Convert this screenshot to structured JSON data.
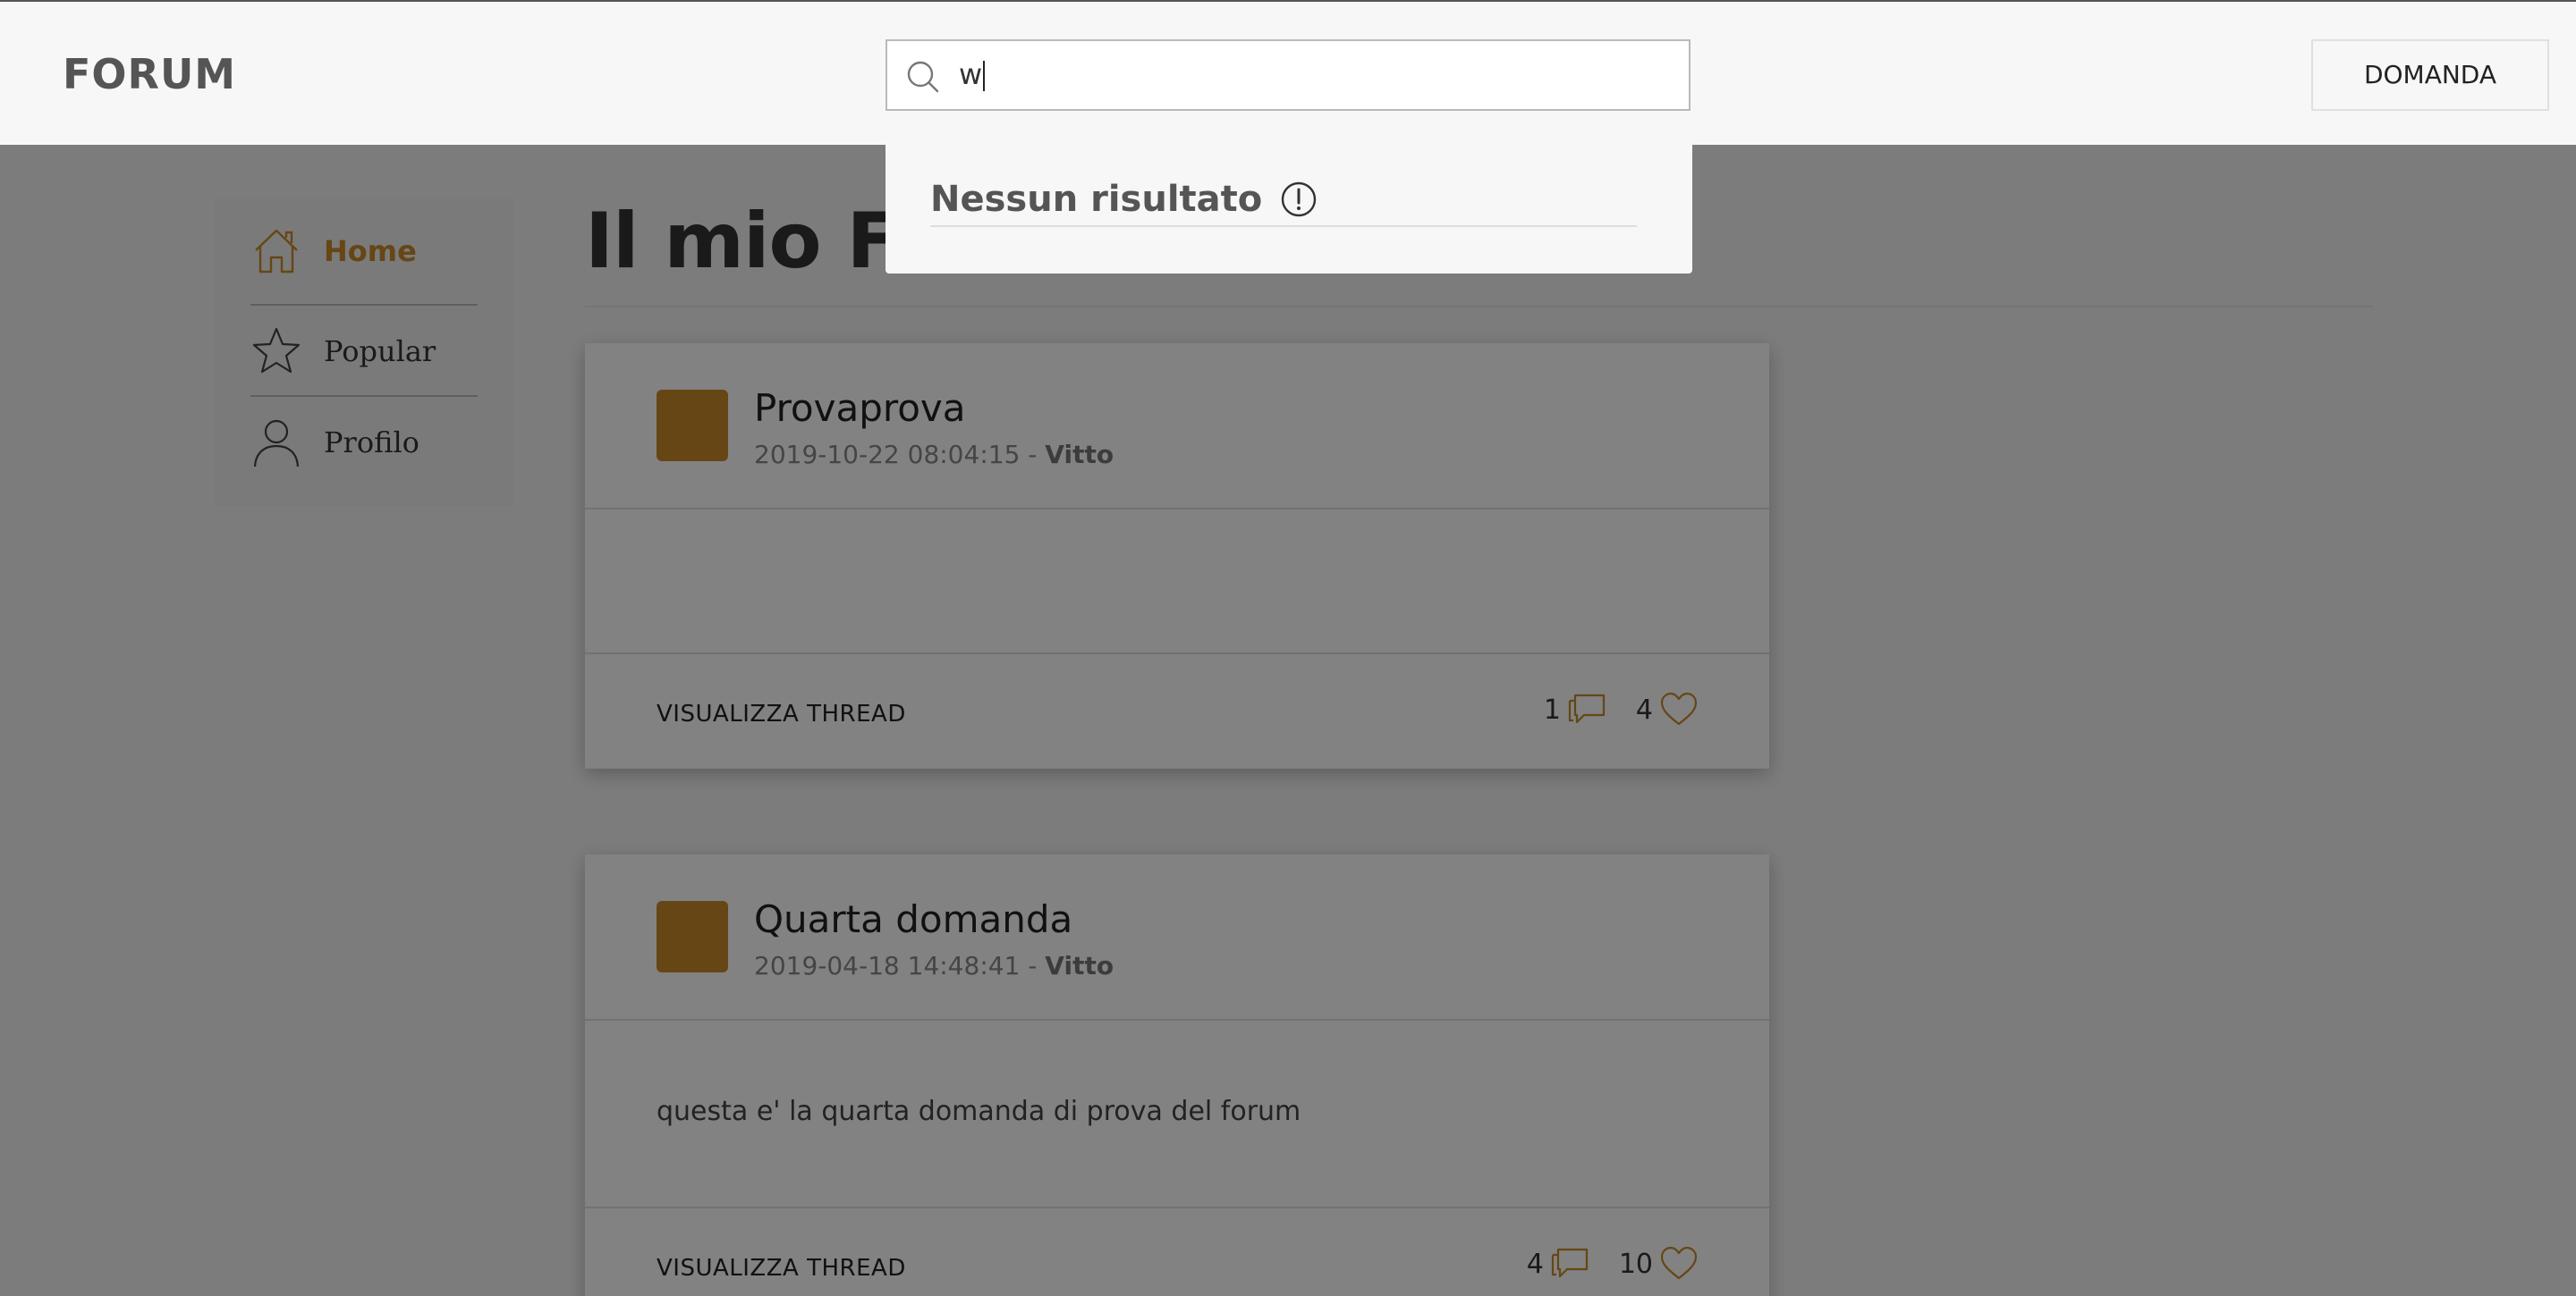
{
  "header": {
    "logo": "FORUM",
    "search": {
      "value": "w",
      "placeholder": ""
    },
    "ask_button": "DOMANDA"
  },
  "search_dropdown": {
    "message": "Nessun risultato"
  },
  "sidebar": {
    "items": [
      {
        "label": "Home",
        "icon": "home-icon",
        "active": true
      },
      {
        "label": "Popular",
        "icon": "star-icon",
        "active": false
      },
      {
        "label": "Profilo",
        "icon": "user-icon",
        "active": false
      }
    ]
  },
  "main": {
    "title": "Il mio Feed",
    "posts": [
      {
        "title": "Provaprova",
        "date": "2019-10-22 08:04:15",
        "separator": " - ",
        "author": "Vitto",
        "body": "",
        "view_label": "VISUALIZZA THREAD",
        "comments": "1",
        "likes": "4"
      },
      {
        "title": "Quarta domanda",
        "date": "2019-04-18 14:48:41",
        "separator": " - ",
        "author": "Vitto",
        "body": "questa e' la quarta domanda di prova del forum",
        "view_label": "VISUALIZZA THREAD",
        "comments": "4",
        "likes": "10"
      }
    ]
  },
  "colors": {
    "accent": "#c98a2a",
    "overlay": "rgba(0,0,0,0.49)",
    "header_bg": "#f7f7f7"
  }
}
